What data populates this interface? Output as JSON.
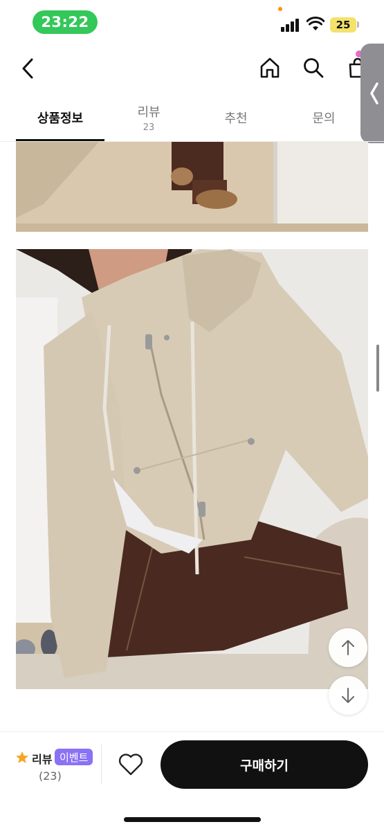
{
  "status_bar": {
    "time": "23:22",
    "battery": "25"
  },
  "header": {
    "back_icon": "chevron-left",
    "home_icon": "home",
    "search_icon": "magnifier",
    "cart_icon": "shopping-bag"
  },
  "tabs": [
    {
      "label": "상품정보",
      "count": "",
      "active": true
    },
    {
      "label": "리뷰",
      "count": "23",
      "active": false
    },
    {
      "label": "추천",
      "count": "",
      "active": false
    },
    {
      "label": "문의",
      "count": "",
      "active": false
    }
  ],
  "scroll_buttons": {
    "up_icon": "arrow-up",
    "down_icon": "arrow-down"
  },
  "bottom_bar": {
    "review_label": "리뷰",
    "event_badge": "이벤트",
    "review_count": "(23)",
    "buy_label": "구매하기",
    "accent_color": "#8b72f5",
    "star_color": "#f5a623"
  }
}
